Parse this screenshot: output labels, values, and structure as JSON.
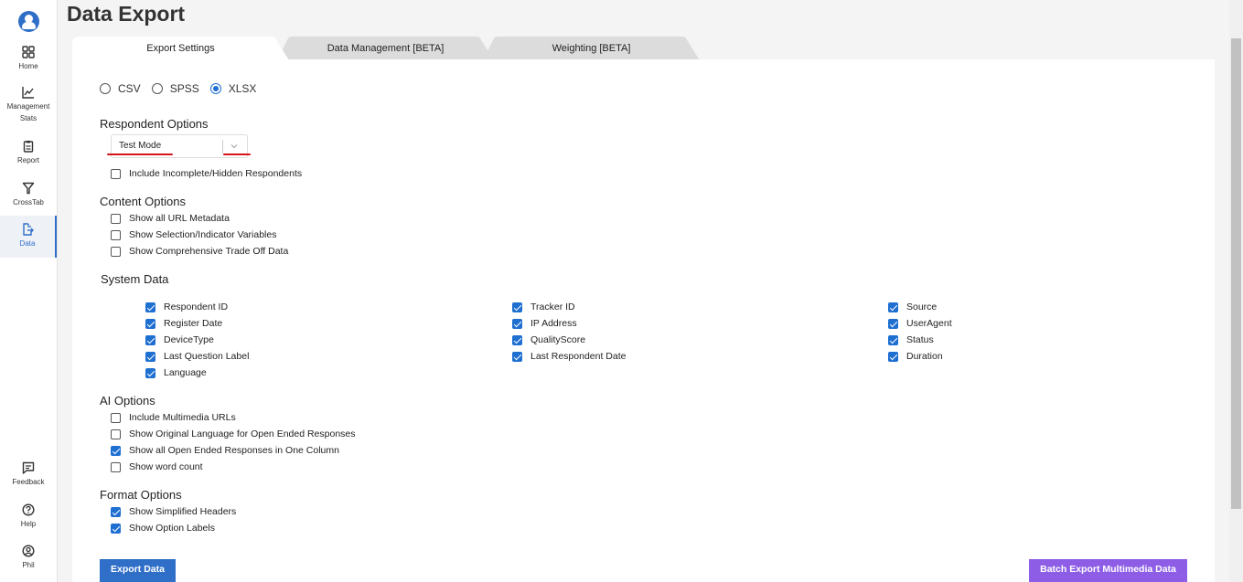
{
  "sidebar": {
    "items": [
      {
        "label": "Home",
        "icon": "grid-icon"
      },
      {
        "label": "Management\nStats",
        "icon": "chart-line-icon"
      },
      {
        "label": "Report",
        "icon": "clipboard-icon"
      },
      {
        "label": "CrossTab",
        "icon": "funnel-icon"
      },
      {
        "label": "Data",
        "icon": "file-export-icon"
      }
    ],
    "bottom_items": [
      {
        "label": "Feedback",
        "icon": "feedback-icon"
      },
      {
        "label": "Help",
        "icon": "help-icon"
      },
      {
        "label": "Phil",
        "icon": "user-icon"
      }
    ]
  },
  "header": {
    "title": "Data Export"
  },
  "tabs": [
    {
      "label": "Export Settings",
      "active": true
    },
    {
      "label": "Data Management [BETA]",
      "active": false
    },
    {
      "label": "Weighting [BETA]",
      "active": false
    }
  ],
  "formats": [
    {
      "label": "CSV",
      "checked": false
    },
    {
      "label": "SPSS",
      "checked": false
    },
    {
      "label": "XLSX",
      "checked": true
    }
  ],
  "respondent_options": {
    "title": "Respondent Options",
    "select_value": "Test Mode",
    "checkboxes": [
      {
        "label": "Include Incomplete/Hidden Respondents",
        "checked": false
      }
    ]
  },
  "content_options": {
    "title": "Content Options",
    "checkboxes": [
      {
        "label": "Show all URL Metadata",
        "checked": false
      },
      {
        "label": "Show Selection/Indicator Variables",
        "checked": false
      },
      {
        "label": "Show Comprehensive Trade Off Data",
        "checked": false
      }
    ]
  },
  "system_data": {
    "title": "System Data",
    "col1": [
      {
        "label": "Respondent ID",
        "checked": true
      },
      {
        "label": "Register Date",
        "checked": true
      },
      {
        "label": "DeviceType",
        "checked": true
      },
      {
        "label": "Last Question Label",
        "checked": true
      },
      {
        "label": "Language",
        "checked": true
      }
    ],
    "col2": [
      {
        "label": "Tracker ID",
        "checked": true
      },
      {
        "label": "IP Address",
        "checked": true
      },
      {
        "label": "QualityScore",
        "checked": true
      },
      {
        "label": "Last Respondent Date",
        "checked": true
      }
    ],
    "col3": [
      {
        "label": "Source",
        "checked": true
      },
      {
        "label": "UserAgent",
        "checked": true
      },
      {
        "label": "Status",
        "checked": true
      },
      {
        "label": "Duration",
        "checked": true
      }
    ]
  },
  "ai_options": {
    "title": "AI Options",
    "checkboxes": [
      {
        "label": "Include Multimedia URLs",
        "checked": false
      },
      {
        "label": "Show Original Language for Open Ended Responses",
        "checked": false
      },
      {
        "label": "Show all Open Ended Responses in One Column",
        "checked": true
      },
      {
        "label": "Show word count",
        "checked": false
      }
    ]
  },
  "format_options": {
    "title": "Format Options",
    "checkboxes": [
      {
        "label": "Show Simplified Headers",
        "checked": true
      },
      {
        "label": "Show Option Labels",
        "checked": true
      }
    ]
  },
  "buttons": {
    "export": "Export Data",
    "batch": "Batch Export Multimedia Data"
  },
  "colors": {
    "primary": "#2f6fc8",
    "batch": "#8d5de6",
    "annotation": "#d8131b"
  }
}
